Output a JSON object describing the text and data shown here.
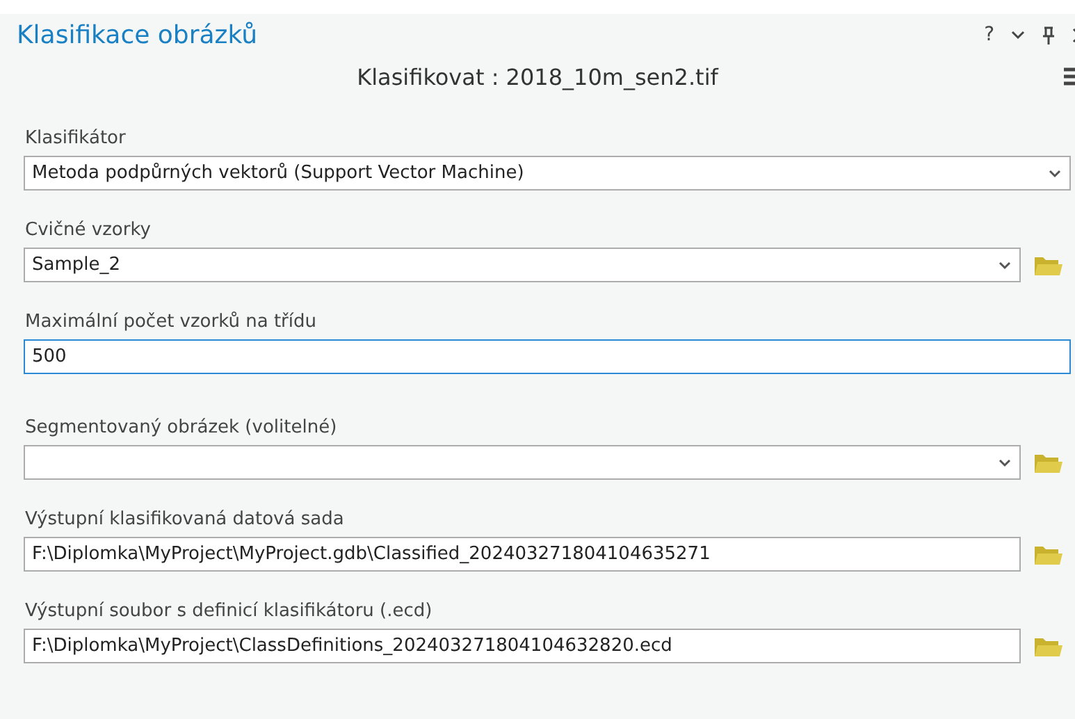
{
  "pane": {
    "title": "Klasifikace obrázků",
    "help": "?"
  },
  "tool": {
    "title": "Klasifikovat : 2018_10m_sen2.tif"
  },
  "parameters": [
    {
      "label": "Klasifikátor",
      "kind": "dropdown",
      "value": "Metoda podpůrných vektorů (Support Vector Machine)",
      "browse": false,
      "focused": false
    },
    {
      "label": "Cvičné vzorky",
      "kind": "dropdown",
      "value": "Sample_2",
      "browse": true,
      "focused": false
    },
    {
      "label": "Maximální počet vzorků na třídu",
      "kind": "text",
      "value": "500",
      "browse": false,
      "focused": true
    },
    {
      "label": "Segmentovaný obrázek (volitelné)",
      "kind": "dropdown",
      "browse": true,
      "focused": false
    },
    {
      "label": "Výstupní klasifikovaná datová sada",
      "kind": "text",
      "value": "F:\\Diplomka\\MyProject\\MyProject.gdb\\Classified_202403271804104635271",
      "browse": true,
      "focused": false
    },
    {
      "label": "Výstupní soubor s definicí klasifikátoru (.ecd)",
      "kind": "text",
      "value": "F:\\Diplomka\\MyProject\\ClassDefinitions_202403271804104632820.ecd",
      "browse": true,
      "focused": false
    }
  ]
}
